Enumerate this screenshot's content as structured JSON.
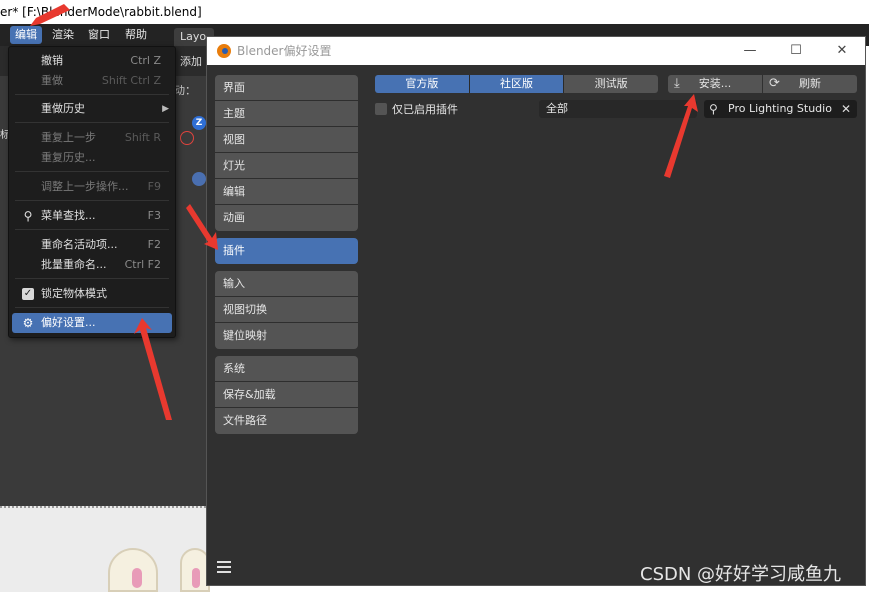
{
  "main_window": {
    "title": "er* [F:\\BlenderMode\\rabbit.blend]"
  },
  "menubar": {
    "items": [
      "编辑",
      "渲染",
      "窗口",
      "帮助"
    ],
    "layout_tab": "Layo"
  },
  "viewport": {
    "add_label": "添加",
    "dong_label": "动：",
    "side_label": "标",
    "gizmo_z": "Z"
  },
  "edit_menu": {
    "undo": {
      "label": "撤销",
      "shortcut": "Ctrl Z"
    },
    "redo": {
      "label": "重做",
      "shortcut": "Shift Ctrl Z"
    },
    "undo_history": {
      "label": "重做历史"
    },
    "repeat_last": {
      "label": "重复上一步",
      "shortcut": "Shift R"
    },
    "repeat_history": {
      "label": "重复历史..."
    },
    "adjust_last": {
      "label": "调整上一步操作...",
      "shortcut": "F9"
    },
    "menu_search": {
      "label": "菜单查找...",
      "shortcut": "F3"
    },
    "rename_active": {
      "label": "重命名活动项...",
      "shortcut": "F2"
    },
    "batch_rename": {
      "label": "批量重命名...",
      "shortcut": "Ctrl F2"
    },
    "lock_object_modes": {
      "label": "锁定物体模式"
    },
    "preferences": {
      "label": "偏好设置..."
    }
  },
  "preferences": {
    "title": "Blender偏好设置",
    "nav_group1": [
      "界面",
      "主题",
      "视图",
      "灯光",
      "编辑",
      "动画"
    ],
    "nav_group2": [
      "插件"
    ],
    "nav_group3": [
      "输入",
      "视图切换",
      "键位映射"
    ],
    "nav_group4": [
      "系统",
      "保存&加载",
      "文件路径"
    ],
    "tabs": [
      "官方版",
      "社区版",
      "测试版"
    ],
    "install_label": "安装...",
    "refresh_label": "刷新",
    "only_enabled_label": "仅已启用插件",
    "category_value": "全部",
    "search_value": "Pro Lighting Studio"
  },
  "watermark": "CSDN @好好学习咸鱼九",
  "colors": {
    "accent": "#4772b3",
    "panel_bg": "#303030",
    "annotation": "#e8392f"
  }
}
